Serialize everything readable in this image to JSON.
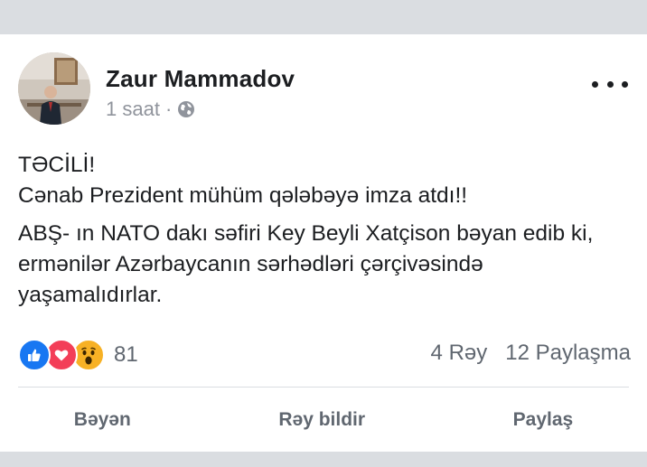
{
  "post": {
    "author_name": "Zaur Mammadov",
    "time": "1 saat",
    "separator": "·",
    "privacy_icon": "globe-icon",
    "more_icon": "ellipsis-icon",
    "paragraph_1_line_1": "TƏCİLİ!",
    "paragraph_1_line_2": "Cənab Prezident mühüm qələbəyə imza atdı!!",
    "paragraph_2": "ABŞ- ın NATO dakı səfiri Key Beyli Xatçison bəyan edib ki, ermənilər Azərbaycanın sərhədləri çərçivəsində yaşamalıdırlar."
  },
  "reactions": {
    "icons": [
      "like-icon",
      "love-icon",
      "wow-icon"
    ],
    "count": "81",
    "comments": "4 Rəy",
    "shares": "12 Paylaşma"
  },
  "actions": {
    "like": "Bəyən",
    "comment": "Rəy bildir",
    "share": "Paylaş"
  },
  "colors": {
    "like": "#1877f2",
    "love": "#f33e58",
    "wow": "#f7b125",
    "secondary_text": "#606770"
  }
}
